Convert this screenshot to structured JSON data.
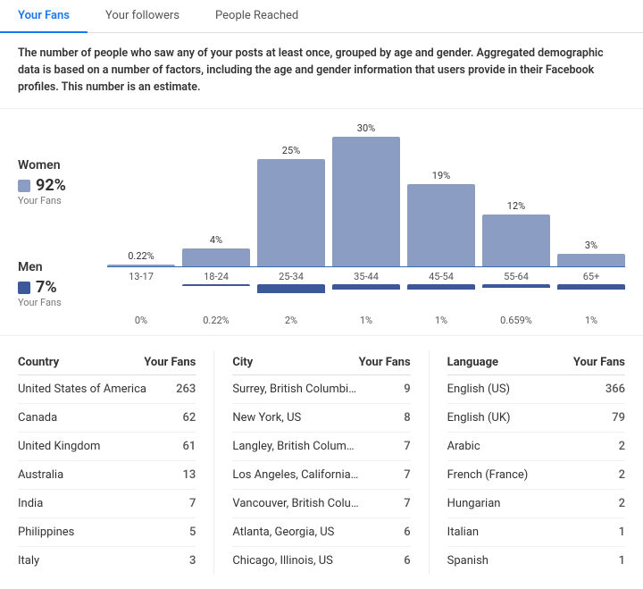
{
  "tabs": [
    {
      "id": "your-fans",
      "label": "Your Fans",
      "active": true
    },
    {
      "id": "your-followers",
      "label": "Your followers",
      "active": false
    },
    {
      "id": "people-reached",
      "label": "People Reached",
      "active": false
    }
  ],
  "description": "The number of people who saw any of your posts at least once, grouped by age and gender. Aggregated demographic data is based on a number of factors, including the age and gender information that users provide in their Facebook profiles. This number is an estimate.",
  "legend": {
    "women": {
      "label": "Women",
      "pct": "92%",
      "sublabel": "Your Fans",
      "color": "#8b9dc3"
    },
    "men": {
      "label": "Men",
      "pct": "7%",
      "sublabel": "Your Fans",
      "color": "#3b5998"
    }
  },
  "bars": [
    {
      "age": "13-17",
      "women_pct": "0.22%",
      "women_height": 2,
      "men_pct": "0%",
      "men_height": 0
    },
    {
      "age": "18-24",
      "women_pct": "4%",
      "women_height": 20,
      "men_pct": "0.22%",
      "men_height": 2
    },
    {
      "age": "25-34",
      "women_pct": "25%",
      "women_height": 120,
      "men_pct": "2%",
      "men_height": 10
    },
    {
      "age": "35-44",
      "women_pct": "30%",
      "women_height": 145,
      "men_pct": "1%",
      "men_height": 6
    },
    {
      "age": "45-54",
      "women_pct": "19%",
      "women_height": 92,
      "men_pct": "1%",
      "men_height": 6
    },
    {
      "age": "55-64",
      "women_pct": "12%",
      "women_height": 58,
      "men_pct": "0.659%",
      "men_height": 4
    },
    {
      "age": "65+",
      "women_pct": "3%",
      "women_height": 14,
      "men_pct": "1%",
      "men_height": 6
    }
  ],
  "countries": {
    "header": {
      "name": "Country",
      "value": "Your Fans"
    },
    "rows": [
      {
        "name": "United States of America",
        "value": "263"
      },
      {
        "name": "Canada",
        "value": "62"
      },
      {
        "name": "United Kingdom",
        "value": "61"
      },
      {
        "name": "Australia",
        "value": "13"
      },
      {
        "name": "India",
        "value": "7"
      },
      {
        "name": "Philippines",
        "value": "5"
      },
      {
        "name": "Italy",
        "value": "3"
      }
    ]
  },
  "cities": {
    "header": {
      "name": "City",
      "value": "Your Fans"
    },
    "rows": [
      {
        "name": "Surrey, British Columbi…",
        "value": "9"
      },
      {
        "name": "New York, US",
        "value": "8"
      },
      {
        "name": "Langley, British Colum…",
        "value": "7"
      },
      {
        "name": "Los Angeles, California…",
        "value": "7"
      },
      {
        "name": "Vancouver, British Colu…",
        "value": "7"
      },
      {
        "name": "Atlanta, Georgia, US",
        "value": "6"
      },
      {
        "name": "Chicago, Illinois, US",
        "value": "6"
      }
    ]
  },
  "languages": {
    "header": {
      "name": "Language",
      "value": "Your Fans"
    },
    "rows": [
      {
        "name": "English (US)",
        "value": "366"
      },
      {
        "name": "English (UK)",
        "value": "79"
      },
      {
        "name": "Arabic",
        "value": "2"
      },
      {
        "name": "French (France)",
        "value": "2"
      },
      {
        "name": "Hungarian",
        "value": "2"
      },
      {
        "name": "Italian",
        "value": "1"
      },
      {
        "name": "Spanish",
        "value": "1"
      }
    ]
  }
}
